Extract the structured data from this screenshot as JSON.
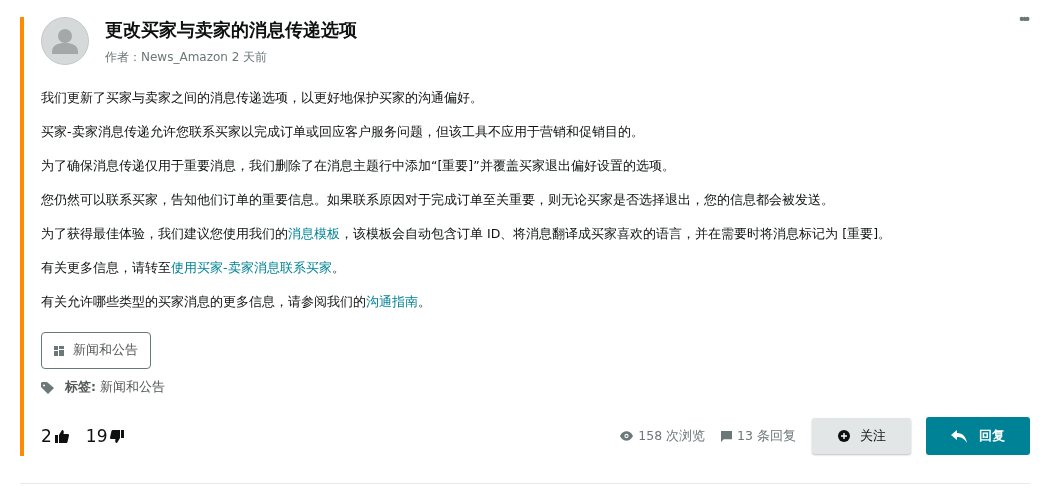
{
  "post": {
    "title": "更改买家与卖家的消息传递选项",
    "byline": "作者：News_Amazon 2 天前",
    "menu": "•••",
    "paragraphs": [
      [
        {
          "text": "我们更新了买家与卖家之间的消息传递选项，以更好地保护买家的沟通偏好。",
          "link": false
        }
      ],
      [
        {
          "text": "买家-卖家消息传递允许您联系买家以完成订单或回应客户服务问题，但该工具不应用于营销和促销目的。",
          "link": false
        }
      ],
      [
        {
          "text": "为了确保消息传递仅用于重要消息，我们删除了在消息主题行中添加“[重要]”并覆盖买家退出偏好设置的选项。",
          "link": false
        }
      ],
      [
        {
          "text": "您仍然可以联系买家，告知他们订单的重要信息。如果联系原因对于完成订单至关重要，则无论买家是否选择退出，您的信息都会被发送。",
          "link": false
        }
      ],
      [
        {
          "text": "为了获得最佳体验，我们建议您使用我们的",
          "link": false
        },
        {
          "text": "消息模板",
          "link": true
        },
        {
          "text": "，该模板会自动包含订单 ID、将消息翻译成买家喜欢的语言，并在需要时将消息标记为 [重要]。",
          "link": false
        }
      ],
      [
        {
          "text": "有关更多信息，请转至",
          "link": false
        },
        {
          "text": "使用买家-卖家消息联系买家",
          "link": true
        },
        {
          "text": "。",
          "link": false
        }
      ],
      [
        {
          "text": "有关允许哪些类型的买家消息的更多信息，请参阅我们的",
          "link": false
        },
        {
          "text": "沟通指南",
          "link": true
        },
        {
          "text": "。",
          "link": false
        }
      ]
    ],
    "board": "新闻和公告",
    "tags_label": "标签:",
    "tag": "新闻和公告",
    "likes": "2",
    "dislikes": "19",
    "views": "158 次浏览",
    "replies": "13 条回复",
    "follow_button": "关注",
    "reply_button": "回复"
  }
}
